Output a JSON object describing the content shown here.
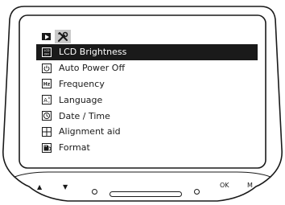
{
  "tabs": [
    {
      "name": "playback",
      "icon": "play-icon",
      "active": false
    },
    {
      "name": "settings",
      "icon": "tools-icon",
      "active": true
    }
  ],
  "menu": {
    "items": [
      {
        "label": "LCD Brightness",
        "icon": "lcd-off-icon",
        "icon_text": "LCD OFF",
        "selected": true
      },
      {
        "label": "Auto Power Off",
        "icon": "power-icon",
        "selected": false
      },
      {
        "label": "Frequency",
        "icon": "hz-icon",
        "icon_text": "Hz",
        "selected": false
      },
      {
        "label": "Language",
        "icon": "language-icon",
        "icon_text": "A",
        "selected": false
      },
      {
        "label": "Date / Time",
        "icon": "clock-icon",
        "selected": false
      },
      {
        "label": "Alignment aid",
        "icon": "grid-icon",
        "selected": false
      },
      {
        "label": "Format",
        "icon": "sd-card-icon",
        "selected": false
      }
    ]
  },
  "buttons": {
    "up": "▲",
    "down": "▼",
    "ok": "OK",
    "m": "M"
  },
  "colors": {
    "selected_bg": "#1a1a1a",
    "selected_text": "#ffffff",
    "text": "#1a1a1a",
    "active_tab_bg": "#c9c9c9"
  }
}
